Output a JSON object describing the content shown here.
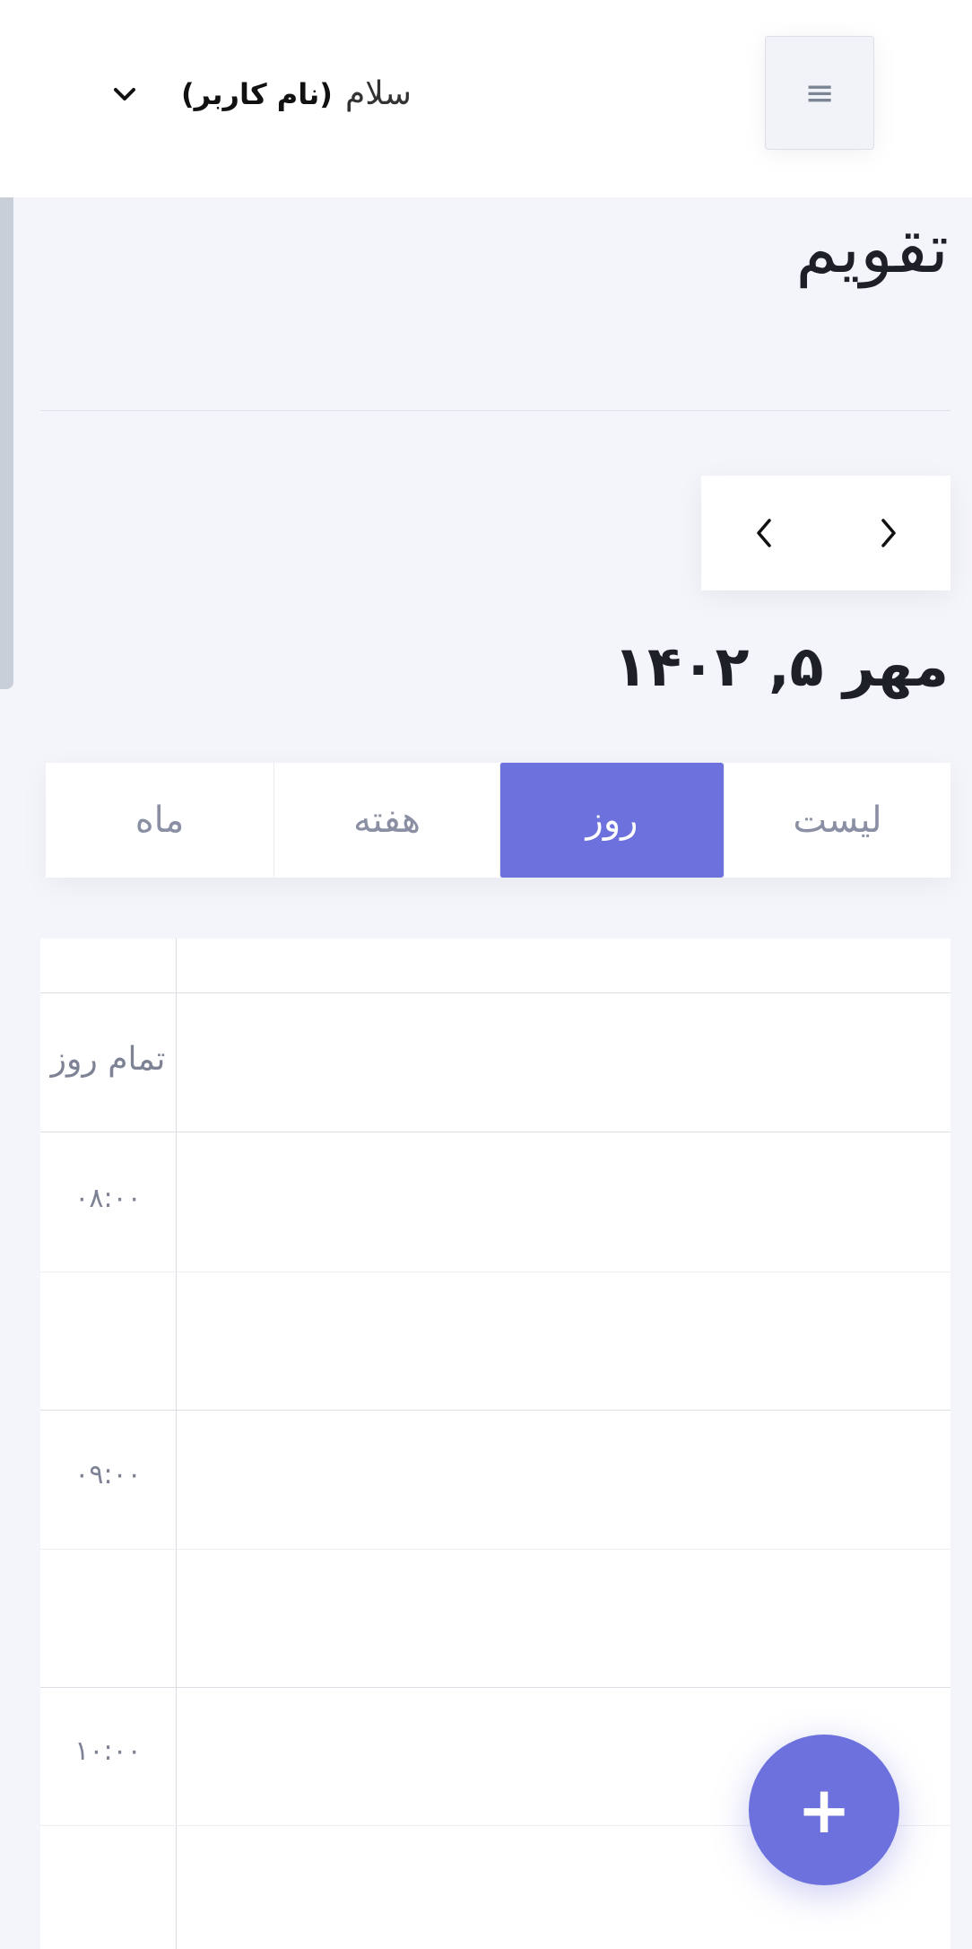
{
  "header": {
    "greeting": "سلام",
    "username": "(نام کاربر)",
    "menu_icon": "hamburger-icon",
    "dropdown_icon": "chevron-down-icon"
  },
  "page": {
    "title": "تقویم",
    "date": "مهر ۵, ۱۴۰۲"
  },
  "navigation": {
    "prev_icon": "chevron-left-icon",
    "next_icon": "chevron-right-icon"
  },
  "tabs": [
    {
      "label": "لیست",
      "active": false
    },
    {
      "label": "روز",
      "active": true
    },
    {
      "label": "هفته",
      "active": false
    },
    {
      "label": "ماه",
      "active": false
    }
  ],
  "calendar": {
    "all_day_label": "تمام روز",
    "time_slots": [
      "۰۸:۰۰",
      "۰۹:۰۰",
      "۱۰:۰۰"
    ]
  },
  "fab": {
    "icon": "plus-icon",
    "label": "+"
  },
  "colors": {
    "accent": "#6c71de",
    "background": "#f4f5fa"
  }
}
